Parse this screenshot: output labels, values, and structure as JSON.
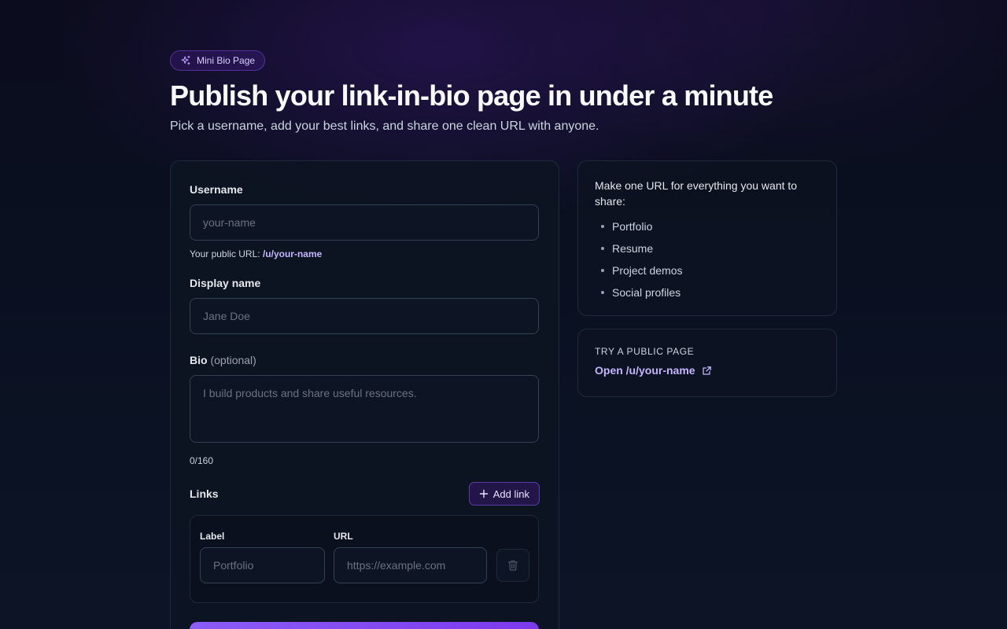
{
  "header": {
    "badge": "Mini Bio Page",
    "title": "Publish your link-in-bio page in under a minute",
    "subtitle": "Pick a username, add your best links, and share one clean URL with anyone."
  },
  "form": {
    "username": {
      "label": "Username",
      "placeholder": "your-name",
      "value": "",
      "help_prefix": "Your public URL: ",
      "help_url": "/u/your-name"
    },
    "display_name": {
      "label": "Display name",
      "placeholder": "Jane Doe",
      "value": ""
    },
    "bio": {
      "label": "Bio",
      "optional": "(optional)",
      "placeholder": "I build products and share useful resources.",
      "counter": "0/160"
    },
    "links": {
      "label": "Links",
      "add_label": "Add link",
      "rows": [
        {
          "label_header": "Label",
          "url_header": "URL",
          "label_placeholder": "Portfolio",
          "url_placeholder": "https://example.com"
        }
      ]
    }
  },
  "side": {
    "intro": "Make one URL for everything you want to share:",
    "items": [
      "Portfolio",
      "Resume",
      "Project demos",
      "Social profiles"
    ],
    "try": {
      "eyebrow": "TRY A PUBLIC PAGE",
      "link": "Open /u/your-name"
    }
  },
  "colors": {
    "accent": "#8b5cf6",
    "accent_text": "#c4b5fd",
    "card_bg": "#0d1322",
    "border": "#1f2a3c"
  },
  "icons": {
    "badge": "sparkles-icon",
    "add": "plus-icon",
    "delete": "trash-icon",
    "external": "external-link-icon"
  }
}
